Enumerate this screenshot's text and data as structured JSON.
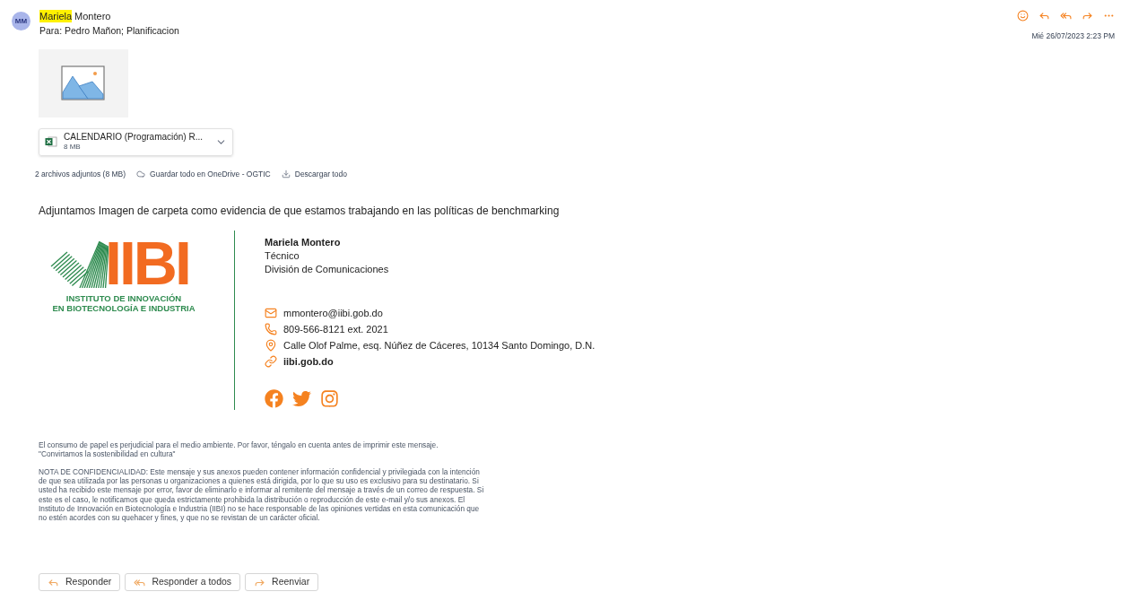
{
  "header": {
    "avatar": "MM",
    "sender_highlight": "Mariela",
    "sender_rest": "Montero",
    "to": "Para: Pedro Mañon; Planificacion",
    "date": "Mié 26/07/2023 2:23 PM"
  },
  "attachments": {
    "file": {
      "name": "CALENDARIO (Programación) R...",
      "size": "8 MB"
    },
    "summary": "2 archivos adjuntos (8 MB)",
    "actions": [
      {
        "kind": "cloud",
        "label": "Guardar todo en OneDrive - OGTIC"
      },
      {
        "kind": "download",
        "label": "Descargar todo"
      }
    ]
  },
  "body": "Adjuntamos Imagen de carpeta como evidencia de que estamos trabajando en las políticas de benchmarking",
  "signature": {
    "logo": {
      "letters": "IIBI",
      "lines": [
        "INSTITUTO DE INNOVACIÓN",
        "EN BIOTECNOLOGÍA E INDUSTRIA"
      ]
    },
    "name": "Mariela Montero",
    "title": "Técnico",
    "department": "División de Comunicaciones",
    "contacts": [
      {
        "kind": "mail",
        "text": "mmontero@iibi.gob.do"
      },
      {
        "kind": "phone",
        "text": "809-566-8121 ext. 2021"
      },
      {
        "kind": "address",
        "text": "Calle Olof Palme, esq. Núñez de Cáceres, 10134 Santo Domingo, D.N."
      },
      {
        "kind": "link",
        "text": "iibi.gob.do"
      }
    ],
    "social": [
      {
        "kind": "facebook"
      },
      {
        "kind": "twitter"
      },
      {
        "kind": "instagram"
      }
    ]
  },
  "disclaimer": [
    "El consumo de papel es perjudicial para el medio ambiente. Por favor, téngalo en cuenta antes de imprimir este mensaje.",
    "\"Convirtamos la sostenibilidad en cultura\"",
    "NOTA DE CONFIDENCIALIDAD: Este mensaje y sus anexos pueden contener información confidencial y privilegiada con la intención de que sea utilizada por las personas u organizaciones a quienes está dirigida, por lo que su uso es exclusivo para su destinatario. Si usted ha recibido este mensaje por error, favor de eliminarlo e informar al remitente del mensaje a través de un correo de respuesta. Si este es el caso, le notificamos que queda estrictamente prohibida la distribución o reproducción de este e-mail y/o sus anexos. El Instituto de Innovación en Biotecnología e Industria (IIBI) no se hace responsable de las opiniones vertidas en esta comunicación que no estén acordes con su quehacer y fines, y que no se revistan de un carácter oficial."
  ],
  "buttons": [
    {
      "kind": "reply",
      "label": "Responder"
    },
    {
      "kind": "reply_all",
      "label": "Responder a todos"
    },
    {
      "kind": "forward",
      "label": "Reenviar"
    }
  ]
}
